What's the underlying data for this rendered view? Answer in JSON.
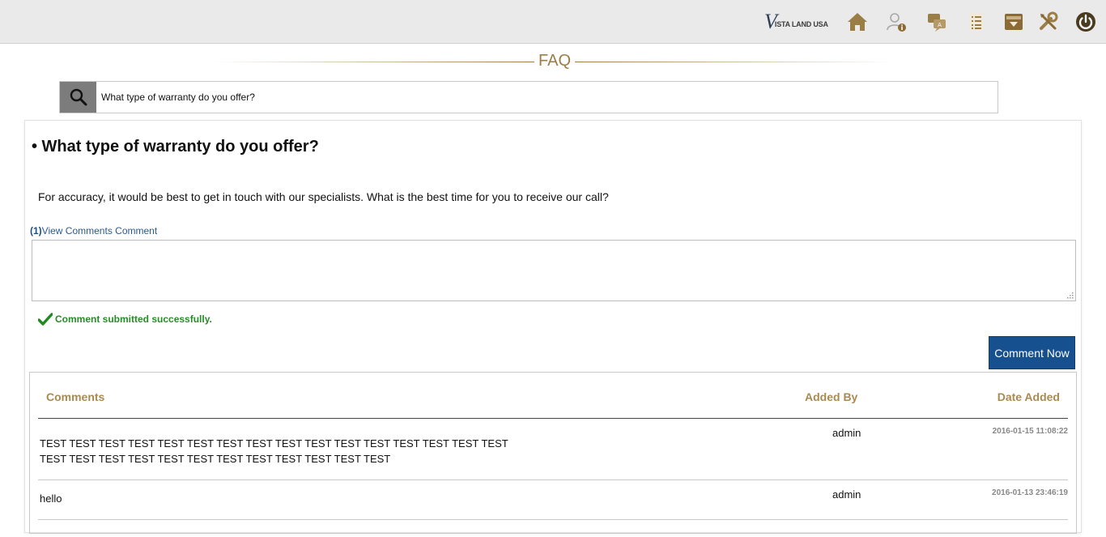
{
  "header": {
    "logo_mark": "V",
    "logo_text": "ISTA LAND USA",
    "icons": [
      "home-icon",
      "user-info-icon",
      "chat-icon",
      "list-icon",
      "inbox-icon",
      "tools-icon",
      "power-icon"
    ],
    "accent_color": "#9b7d46"
  },
  "page": {
    "title": "FAQ"
  },
  "search": {
    "value": "What type of warranty do you offer?"
  },
  "faq": {
    "question": "• What type of warranty do you offer?",
    "answer": "For accuracy, it would be best to get in touch with our specialists. What is the best time for you to receive our call?",
    "comments_count": "(1)",
    "comments_link_text": "View Comments Comment",
    "comment_placeholder": "",
    "success_message": "Comment submitted successfully.",
    "comment_button": "Comment Now"
  },
  "comments_table": {
    "headers": {
      "comments": "Comments",
      "added_by": "Added By",
      "date_added": "Date Added"
    },
    "rows": [
      {
        "line1": "TEST TEST TEST TEST TEST TEST TEST TEST TEST TEST TEST TEST TEST TEST TEST TEST",
        "line2": "TEST TEST TEST TEST TEST TEST TEST TEST TEST TEST TEST TEST",
        "added_by": "admin",
        "date": "2016-01-15 11:08:22"
      },
      {
        "line1": "hello",
        "line2": "",
        "added_by": "admin",
        "date": "2016-01-13 23:46:19"
      }
    ]
  }
}
